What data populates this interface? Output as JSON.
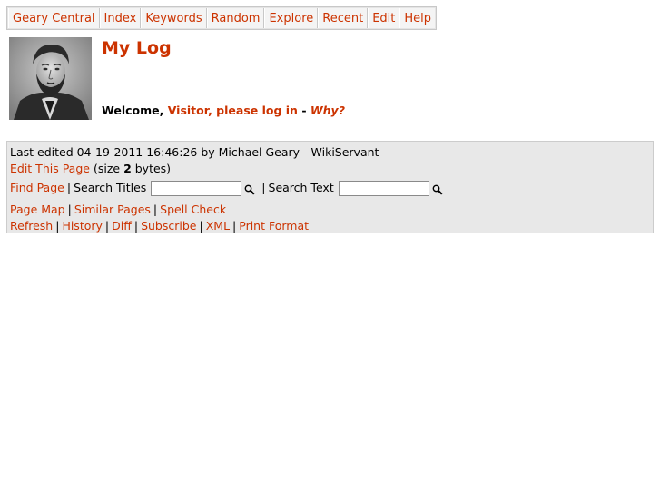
{
  "topnav": {
    "tabs": [
      {
        "label": "Geary Central"
      },
      {
        "label": "Index"
      },
      {
        "label": "Keywords"
      },
      {
        "label": "Random"
      },
      {
        "label": "Explore"
      },
      {
        "label": "Recent"
      },
      {
        "label": "Edit"
      },
      {
        "label": "Help"
      }
    ]
  },
  "page": {
    "title": "My Log",
    "welcome_prefix": "Welcome,",
    "login_link": "Visitor, please log in",
    "dash": "-",
    "why_link": "Why?"
  },
  "footer": {
    "last_edited": "Last edited 04-19-2011 16:46:26 by Michael Geary - WikiServant",
    "edit_page": "Edit This Page",
    "size_prefix": "(size",
    "size_value": "2",
    "size_suffix": "bytes)",
    "find_page": "Find Page",
    "search_titles_label": "Search Titles",
    "search_titles_value": "",
    "search_text_label": "Search Text",
    "search_text_value": "",
    "links_row1": [
      "Page Map",
      "Similar Pages",
      "Spell Check"
    ],
    "links_row2": [
      "Refresh",
      "History",
      "Diff",
      "Subscribe",
      "XML",
      "Print Format"
    ]
  },
  "colors": {
    "link": "#cc3300",
    "footer_bg": "#e8e8e8"
  }
}
